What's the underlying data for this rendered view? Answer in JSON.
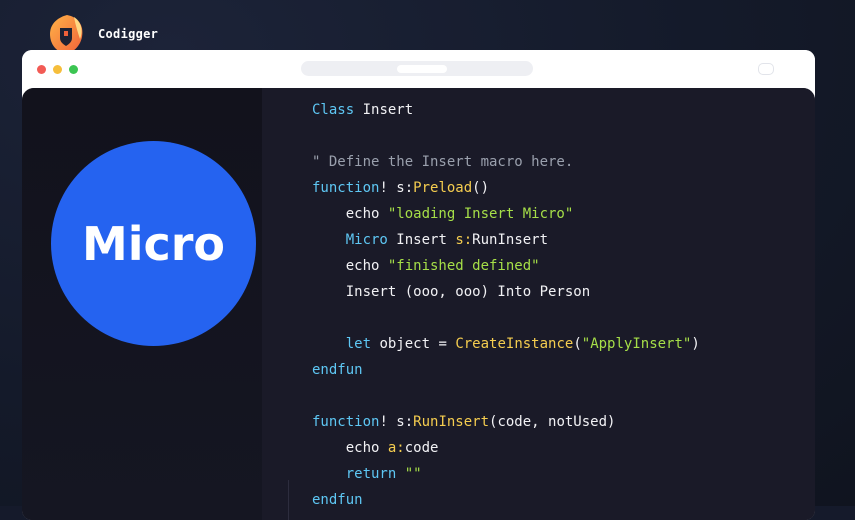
{
  "brand": {
    "name": "Codigger",
    "logo_icon": "shield-flame-logo-icon"
  },
  "window": {
    "controls": [
      "close-dot",
      "minimize-dot",
      "maximize-dot"
    ],
    "colors": {
      "close": "#f25b55",
      "minimize": "#f6be3b",
      "maximize": "#3cc552"
    }
  },
  "hero": {
    "label": "Micro",
    "color": "#2563f0"
  },
  "code": {
    "lines": [
      [
        {
          "t": "Class",
          "c": "kw"
        },
        {
          "t": " Insert",
          "c": ""
        }
      ],
      [],
      [
        {
          "t": "\" Define the Insert macro here.",
          "c": "cm"
        }
      ],
      [
        {
          "t": "function",
          "c": "kw"
        },
        {
          "t": "! ",
          "c": ""
        },
        {
          "t": "s:",
          "c": ""
        },
        {
          "t": "Preload",
          "c": "fn"
        },
        {
          "t": "()",
          "c": ""
        }
      ],
      [
        {
          "t": "    echo ",
          "c": ""
        },
        {
          "t": "\"loading Insert Micro\"",
          "c": "str"
        }
      ],
      [
        {
          "t": "    ",
          "c": ""
        },
        {
          "t": "Micro",
          "c": "kw"
        },
        {
          "t": " Insert ",
          "c": ""
        },
        {
          "t": "s:",
          "c": "sc"
        },
        {
          "t": "RunInsert",
          "c": ""
        }
      ],
      [
        {
          "t": "    echo ",
          "c": ""
        },
        {
          "t": "\"finished defined\"",
          "c": "str"
        }
      ],
      [
        {
          "t": "    Insert (ooo, ooo) Into Person",
          "c": ""
        }
      ],
      [],
      [
        {
          "t": "    ",
          "c": ""
        },
        {
          "t": "let",
          "c": "kw"
        },
        {
          "t": " object = ",
          "c": ""
        },
        {
          "t": "CreateInstance",
          "c": "fn"
        },
        {
          "t": "(",
          "c": ""
        },
        {
          "t": "\"ApplyInsert\"",
          "c": "str"
        },
        {
          "t": ")",
          "c": ""
        }
      ],
      [
        {
          "t": "endfun",
          "c": "kw"
        }
      ],
      [],
      [
        {
          "t": "function",
          "c": "kw"
        },
        {
          "t": "! ",
          "c": ""
        },
        {
          "t": "s:",
          "c": ""
        },
        {
          "t": "RunInsert",
          "c": "fn"
        },
        {
          "t": "(code, notUsed)",
          "c": ""
        }
      ],
      [
        {
          "t": "    echo ",
          "c": ""
        },
        {
          "t": "a:",
          "c": "sc"
        },
        {
          "t": "code",
          "c": ""
        }
      ],
      [
        {
          "t": "    ",
          "c": ""
        },
        {
          "t": "return",
          "c": "kw"
        },
        {
          "t": " ",
          "c": ""
        },
        {
          "t": "\"\"",
          "c": "str"
        }
      ],
      [
        {
          "t": "endfun",
          "c": "kw"
        }
      ]
    ]
  }
}
